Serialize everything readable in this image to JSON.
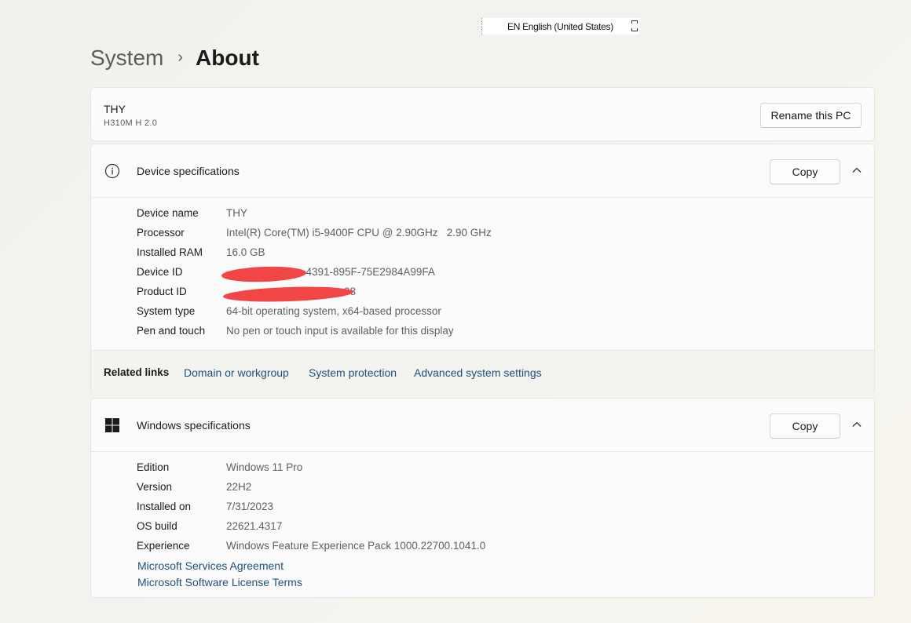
{
  "language_bar": {
    "label": "EN English (United States)"
  },
  "breadcrumb": {
    "parent": "System",
    "separator": "›",
    "current": "About"
  },
  "pc": {
    "name": "THY",
    "model": "H310M H 2.0",
    "rename_label": "Rename this PC"
  },
  "device_specs": {
    "title": "Device specifications",
    "copy_label": "Copy",
    "rows": [
      {
        "label": "Device name",
        "value": "THY"
      },
      {
        "label": "Processor",
        "value": "Intel(R) Core(TM) i5-9400F CPU @ 2.90GHz   2.90 GHz"
      },
      {
        "label": "Installed RAM",
        "value": "16.0 GB"
      },
      {
        "label": "Device ID",
        "value": "-4391-895F-75E2984A99FA"
      },
      {
        "label": "Product ID",
        "value": "98"
      },
      {
        "label": "System type",
        "value": "64-bit operating system, x64-based processor"
      },
      {
        "label": "Pen and touch",
        "value": "No pen or touch input is available for this display"
      }
    ],
    "related_links": {
      "label": "Related links",
      "links": [
        "Domain or workgroup",
        "System protection",
        "Advanced system settings"
      ]
    }
  },
  "windows_specs": {
    "title": "Windows specifications",
    "copy_label": "Copy",
    "rows": [
      {
        "label": "Edition",
        "value": "Windows 11 Pro"
      },
      {
        "label": "Version",
        "value": "22H2"
      },
      {
        "label": "Installed on",
        "value": "7/31/2023"
      },
      {
        "label": "OS build",
        "value": "22621.4317"
      },
      {
        "label": "Experience",
        "value": "Windows Feature Experience Pack 1000.22700.1041.0"
      }
    ],
    "links": [
      "Microsoft Services Agreement",
      "Microsoft Software License Terms"
    ]
  },
  "colors": {
    "link": "#1f4f80",
    "redaction": "#f24545",
    "card_bg": "#fbfbfb"
  }
}
